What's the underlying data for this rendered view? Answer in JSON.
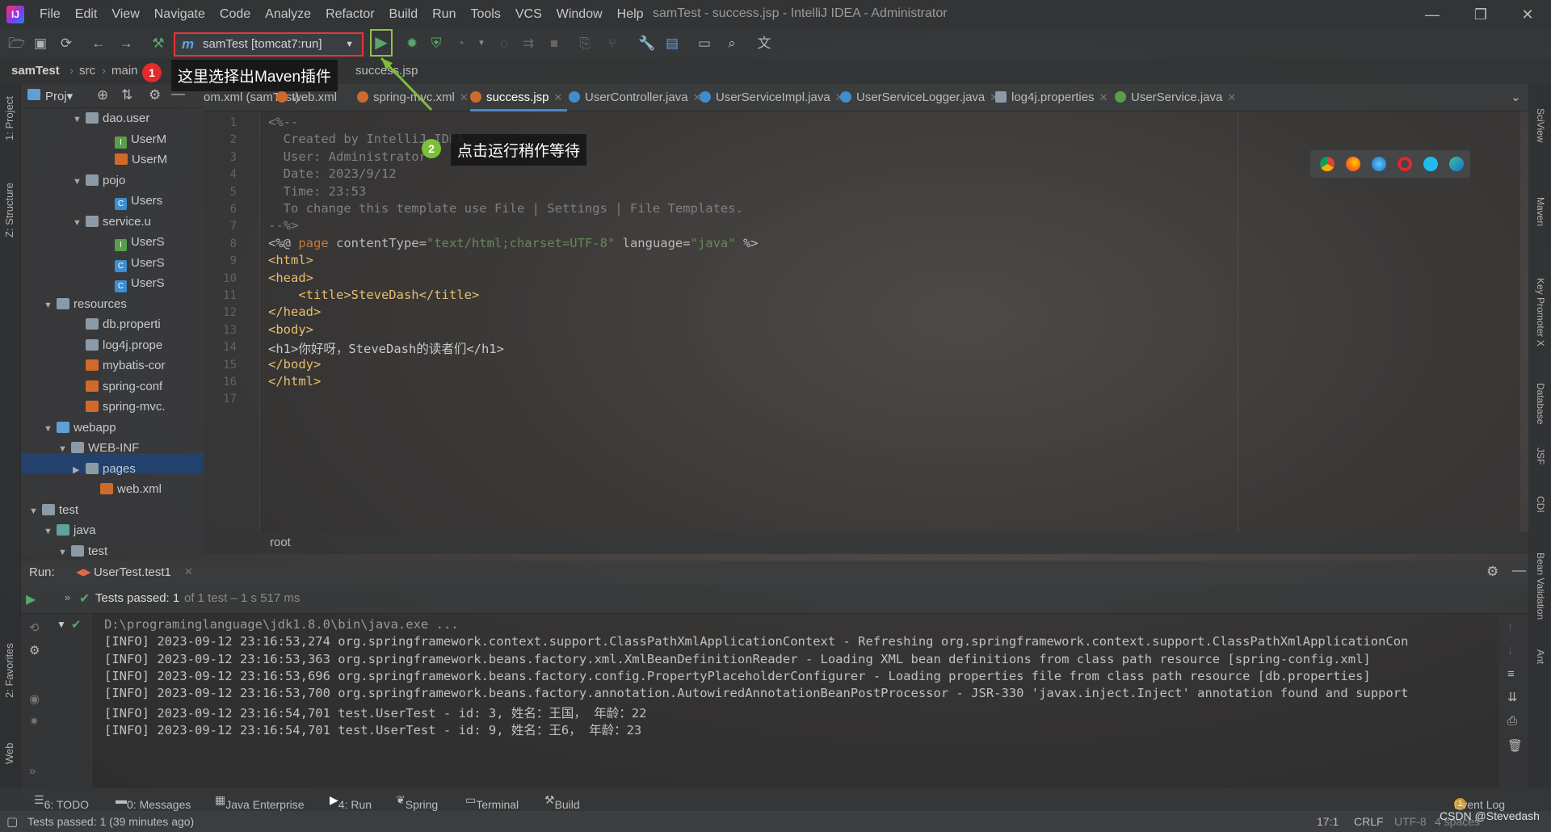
{
  "window": {
    "title": "samTest - success.jsp - IntelliJ IDEA - Administrator",
    "menu": [
      "File",
      "Edit",
      "View",
      "Navigate",
      "Code",
      "Analyze",
      "Refactor",
      "Build",
      "Run",
      "Tools",
      "VCS",
      "Window",
      "Help"
    ]
  },
  "toolbar": {
    "run_config": "samTest [tomcat7:run]"
  },
  "breadcrumb": [
    "samTest",
    "src",
    "main",
    "success.jsp"
  ],
  "annotations": {
    "step1_num": "1",
    "step1_text": "这里选择出Maven插件",
    "step2_num": "2",
    "step2_text": "点击运行稍作等待"
  },
  "project": {
    "head_label": "Proj▾",
    "items": [
      {
        "label": "dao.user",
        "kind": "folder",
        "indent": 5,
        "expanded": true
      },
      {
        "label": "UserM",
        "kind": "iface",
        "indent": 7
      },
      {
        "label": "UserM",
        "kind": "xml",
        "indent": 7
      },
      {
        "label": "pojo",
        "kind": "folder",
        "indent": 5,
        "expanded": true
      },
      {
        "label": "Users",
        "kind": "class",
        "indent": 7
      },
      {
        "label": "service.u",
        "kind": "folder",
        "indent": 5,
        "expanded": true
      },
      {
        "label": "UserS",
        "kind": "iface",
        "indent": 7
      },
      {
        "label": "UserS",
        "kind": "class",
        "indent": 7
      },
      {
        "label": "UserS",
        "kind": "class",
        "indent": 7
      },
      {
        "label": "resources",
        "kind": "folder",
        "indent": 3,
        "expanded": true
      },
      {
        "label": "db.properti",
        "kind": "prop",
        "indent": 5
      },
      {
        "label": "log4j.prope",
        "kind": "prop",
        "indent": 5
      },
      {
        "label": "mybatis-cor",
        "kind": "xml",
        "indent": 5
      },
      {
        "label": "spring-conf",
        "kind": "xml",
        "indent": 5
      },
      {
        "label": "spring-mvc.",
        "kind": "xml",
        "indent": 5
      },
      {
        "label": "webapp",
        "kind": "folder-blue",
        "indent": 3,
        "expanded": true
      },
      {
        "label": "WEB-INF",
        "kind": "folder",
        "indent": 4,
        "expanded": true
      },
      {
        "label": "pages",
        "kind": "folder",
        "indent": 5,
        "expanded": false
      },
      {
        "label": "web.xml",
        "kind": "xml",
        "indent": 6
      },
      {
        "label": "test",
        "kind": "folder",
        "indent": 2,
        "expanded": true
      },
      {
        "label": "java",
        "kind": "folder-teal",
        "indent": 3,
        "expanded": true
      },
      {
        "label": "test",
        "kind": "folder",
        "indent": 4,
        "expanded": true
      }
    ]
  },
  "tabs": [
    {
      "label": "om.xml (samTest)",
      "color": "#6a8fd6"
    },
    {
      "label": "web.xml",
      "color": "#d06a2a"
    },
    {
      "label": "spring-mvc.xml",
      "color": "#d06a2a"
    },
    {
      "label": "success.jsp",
      "color": "#d06a2a",
      "active": true
    },
    {
      "label": "UserController.java",
      "color": "#3e8ecf"
    },
    {
      "label": "UserServiceImpl.java",
      "color": "#3e8ecf"
    },
    {
      "label": "UserServiceLogger.java",
      "color": "#3e8ecf"
    },
    {
      "label": "log4j.properties",
      "color": "#8a9aa8"
    },
    {
      "label": "UserService.java",
      "color": "#5a9e4b"
    }
  ],
  "editor": {
    "line_numbers": [
      "1",
      "2",
      "3",
      "4",
      "5",
      "6",
      "7",
      "8",
      "9",
      "10",
      "11",
      "12",
      "13",
      "14",
      "15",
      "16",
      "17"
    ],
    "lines": [
      "<%--",
      "  Created by IntelliJ IDEA.",
      "  User: Administrator",
      "  Date: 2023/9/12",
      "  Time: 23:53",
      "  To change this template use File | Settings | File Templates.",
      "--%>",
      "",
      "<html>",
      "<head>",
      "    <title>SteveDash</title>",
      "</head>",
      "<body>",
      "<h1>你好呀，SteveDash的读者们</h1>",
      "</body>",
      "</html>",
      ""
    ],
    "line8": {
      "open": "<%@ ",
      "directive": "page",
      "attr1": " contentType=",
      "val1": "\"text/html;charset=UTF-8\"",
      "attr2": " language=",
      "val2": "\"java\"",
      "close": " %>"
    },
    "crumb": "root"
  },
  "run": {
    "label": "Run:",
    "config": "UserTest.test1",
    "status": "Tests passed: 1",
    "status_detail": " of 1 test – 1 s 517 ms",
    "console": [
      "D:\\programinglanguage\\jdk1.8.0\\bin\\java.exe ...",
      "[INFO] 2023-09-12 23:16:53,274 org.springframework.context.support.ClassPathXmlApplicationContext - Refreshing org.springframework.context.support.ClassPathXmlApplicationCon",
      "[INFO] 2023-09-12 23:16:53,363 org.springframework.beans.factory.xml.XmlBeanDefinitionReader - Loading XML bean definitions from class path resource [spring-config.xml]",
      "[INFO] 2023-09-12 23:16:53,696 org.springframework.beans.factory.config.PropertyPlaceholderConfigurer - Loading properties file from class path resource [db.properties]",
      "[INFO] 2023-09-12 23:16:53,700 org.springframework.beans.factory.annotation.AutowiredAnnotationBeanPostProcessor - JSR-330 'javax.inject.Inject' annotation found and support",
      "[INFO] 2023-09-12 23:16:54,701 test.UserTest - id: 3, 姓名：王国， 年龄：22",
      "[INFO] 2023-09-12 23:16:54,701 test.UserTest - id: 9, 姓名：王6， 年龄：23"
    ]
  },
  "bottom_tools": [
    "6: TODO",
    "0: Messages",
    "Java Enterprise",
    "4: Run",
    "Spring",
    "Terminal",
    "Build"
  ],
  "event_log": "Event Log",
  "event_log_count": "1",
  "status": {
    "message": "Tests passed: 1 (39 minutes ago)",
    "position": "17:1",
    "line_sep": "CRLF",
    "encoding": "UTF-8",
    "indent": "4 spaces",
    "watermark": "CSDN @Stevedash"
  },
  "left_tools": [
    "1: Project",
    "Z: Structure",
    "2: Favorites",
    "Web"
  ],
  "right_tools": [
    "SciView",
    "Maven",
    "Key Promoter X",
    "Database",
    "JSF",
    "CDI",
    "Bean Validation",
    "Ant"
  ]
}
